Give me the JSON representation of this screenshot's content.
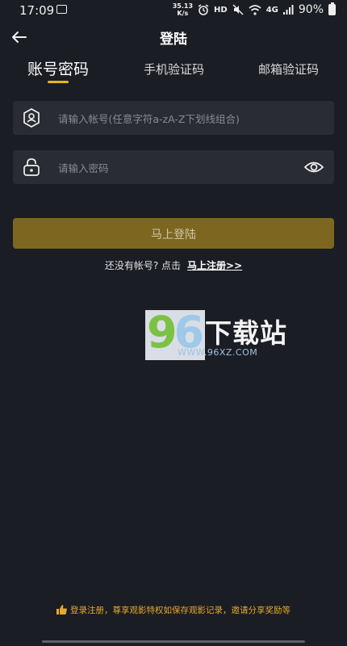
{
  "status_bar": {
    "time": "17:09",
    "speed": "35.13",
    "speed_unit": "K/s",
    "hd": "HD",
    "network": "4G",
    "battery": "90%"
  },
  "header": {
    "title": "登陆"
  },
  "tabs": [
    {
      "label": "账号密码",
      "active": true
    },
    {
      "label": "手机验证码",
      "active": false
    },
    {
      "label": "邮箱验证码",
      "active": false
    }
  ],
  "form": {
    "account_placeholder": "请输入帐号(任意字符a-zA-Z下划线组合)",
    "password_placeholder": "请输入密码",
    "submit_label": "马上登陆"
  },
  "register": {
    "prompt": "还没有帐号? 点击",
    "link": "马上注册>>"
  },
  "watermark": {
    "digit1": "9",
    "digit2": "6",
    "brand": "下载站",
    "url": "WWW.96XZ.COM"
  },
  "promo": {
    "text": "登录注册，尊享观影特权如保存观影记录，邀请分享奖励等"
  },
  "colors": {
    "accent": "#e6b80f",
    "button": "#7d6620",
    "background": "#1b1d24",
    "field": "#2a2c33",
    "promo": "#e5a92a"
  }
}
